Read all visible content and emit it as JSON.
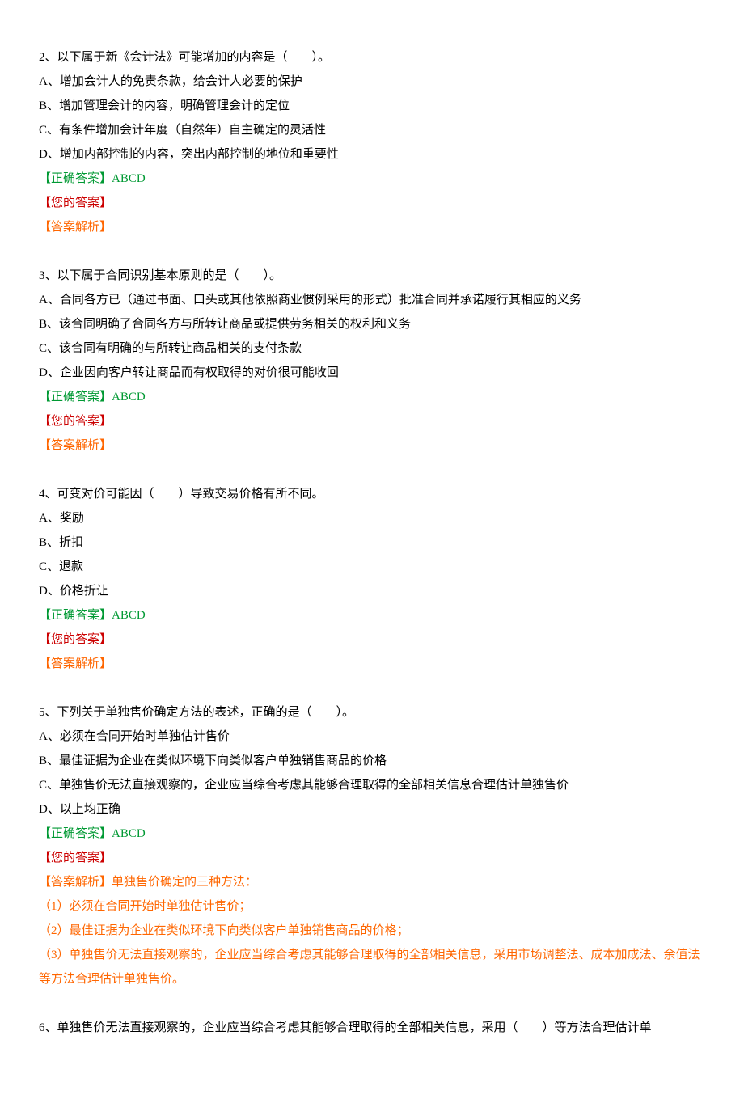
{
  "labels": {
    "correct_prefix": "【正确答案】",
    "your_answer": "【您的答案】",
    "analysis_prefix": "【答案解析】"
  },
  "questions": [
    {
      "stem": "2、以下属于新《会计法》可能增加的内容是（　　）。",
      "options": [
        "A、增加会计人的免责条款，给会计人必要的保护",
        "B、增加管理会计的内容，明确管理会计的定位",
        "C、有条件增加会计年度（自然年）自主确定的灵活性",
        "D、增加内部控制的内容，突出内部控制的地位和重要性"
      ],
      "correct": "ABCD",
      "analysis": []
    },
    {
      "stem": "3、以下属于合同识别基本原则的是（　　）。",
      "options": [
        "A、合同各方已（通过书面、口头或其他依照商业惯例采用的形式）批准合同并承诺履行其相应的义务",
        "B、该合同明确了合同各方与所转让商品或提供劳务相关的权利和义务",
        "C、该合同有明确的与所转让商品相关的支付条款",
        "D、企业因向客户转让商品而有权取得的对价很可能收回"
      ],
      "correct": "ABCD",
      "analysis": []
    },
    {
      "stem": "4、可变对价可能因（　　）导致交易价格有所不同。",
      "options": [
        "A、奖励",
        "B、折扣",
        "C、退款",
        "D、价格折让"
      ],
      "correct": "ABCD",
      "analysis": []
    },
    {
      "stem": "5、下列关于单独售价确定方法的表述，正确的是（　　）。",
      "options": [
        "A、必须在合同开始时单独估计售价",
        "B、最佳证据为企业在类似环境下向类似客户单独销售商品的价格",
        "C、单独售价无法直接观察的，企业应当综合考虑其能够合理取得的全部相关信息合理估计单独售价",
        "D、以上均正确"
      ],
      "correct": "ABCD",
      "analysis": [
        "单独售价确定的三种方法：",
        "（1）必须在合同开始时单独估计售价；",
        "（2）最佳证据为企业在类似环境下向类似客户单独销售商品的价格；",
        "（3）单独售价无法直接观察的，企业应当综合考虑其能够合理取得的全部相关信息，采用市场调整法、成本加成法、余值法等方法合理估计单独售价。"
      ]
    },
    {
      "stem": "6、单独售价无法直接观察的，企业应当综合考虑其能够合理取得的全部相关信息，采用（　　）等方法合理估计单",
      "options": [],
      "correct": "",
      "analysis": [],
      "partial": true
    }
  ]
}
